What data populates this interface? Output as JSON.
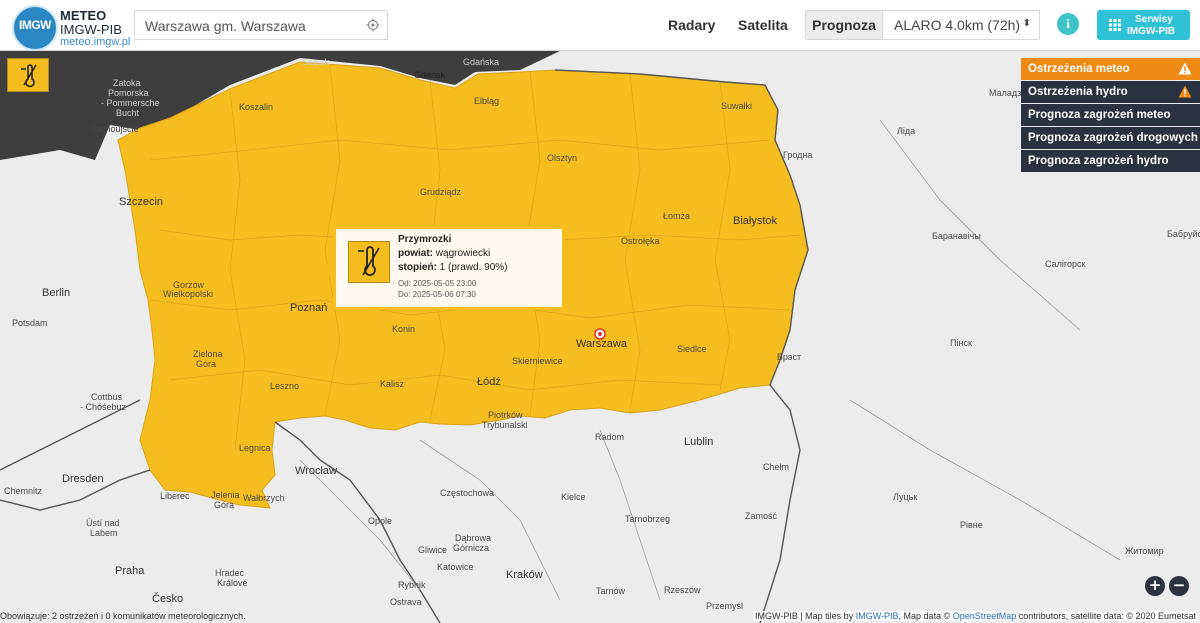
{
  "header": {
    "logo_text": "IMGW",
    "brand_title": "METEO",
    "brand_subtitle": "IMGW-PIB",
    "brand_url": "meteo.imgw.pl",
    "search_value": "Warszawa gm. Warszawa",
    "nav": {
      "radary": "Radary",
      "satelita": "Satelita"
    },
    "prognoza_label": "Prognoza",
    "model_value": "ALARO 4.0km (72h)",
    "info_label": "i",
    "serwisy_line1": "Serwisy",
    "serwisy_line2": "IMGW-PIB"
  },
  "menu": [
    {
      "label": "Ostrzeżenia meteo",
      "active": true,
      "icon": "warning-icon"
    },
    {
      "label": "Ostrzeżenia hydro",
      "active": false,
      "icon": "warning-icon"
    },
    {
      "label": "Prognoza zagrożeń meteo",
      "active": false
    },
    {
      "label": "Prognoza zagrożeń drogowych",
      "active": false
    },
    {
      "label": "Prognoza zagrożeń hydro",
      "active": false
    }
  ],
  "popup": {
    "title": "Przymrozki",
    "powiat_label": "powiat:",
    "powiat_value": "wągrowiecki",
    "stopien_label": "stopień:",
    "stopien_value": "1 (prawd. 90%)",
    "od": "Od: 2025-05-05 23:00",
    "do": "Do: 2025-05-06 07:30"
  },
  "map": {
    "warning_color": "#f5bd1e",
    "cities": {
      "slupsk": "Słupsk",
      "gdansk": "Gdańsk",
      "elblag": "Elbląg",
      "koszalin": "Koszalin",
      "suwalki": "Suwałki",
      "swinoujscie": "Świnoujście",
      "olsztyn": "Olsztyn",
      "szczecin": "Szczecin",
      "grudziadz": "Grudziądz",
      "lomza": "Łomża",
      "bialystok": "Białystok",
      "ostroleka": "Ostrołęka",
      "berlin": "Berlin",
      "gorzow": "Gorzów",
      "gorzow2": "Wielkopolski",
      "poznan": "Poznań",
      "konin": "Konin",
      "potsdam": "Potsdam",
      "warszawa": "Warszawa",
      "siedlce": "Siedlce",
      "skierniewice": "Skierniewice",
      "zielona": "Zielona",
      "gora": "Góra",
      "kalisz": "Kalisz",
      "lodz": "Łódź",
      "leszno": "Leszno",
      "cottbus": "Cottbus",
      "chosebuz": "- Chóśebuz",
      "piotrkow": "Piotrków",
      "trybunalski": "Trybunalski",
      "radom": "Radom",
      "lublin": "Lublin",
      "legnica": "Legnica",
      "wroclaw": "Wrocław",
      "chelm": "Chełm",
      "dresden": "Dresden",
      "chemnitz": "Chemnitz",
      "liberec": "Liberec",
      "jelenia": "Jelenia",
      "gora2": "Góra",
      "walbrzych": "Wałbrzych",
      "czestochowa": "Częstochowa",
      "kielce": "Kielce",
      "usti": "Ústí nad",
      "labem": "Labem",
      "opole": "Opole",
      "dabrowa": "Dąbrowa",
      "gornicza": "Górnicza",
      "tarnobrzeg": "Tarnobrzeg",
      "zamosc": "Zamość",
      "gliwice": "Gliwice",
      "katowice": "Katowice",
      "praha": "Praha",
      "hradec": "Hradec",
      "kralove": "Králové",
      "rybnik": "Rybnik",
      "krakow": "Kraków",
      "tarnow": "Tarnów",
      "rzeszow": "Rzeszów",
      "cesko": "Česko",
      "ostrava": "Ostrava",
      "przemysl": "Przemyśl",
      "malady": "Маладз",
      "lida": "Ліда",
      "grodna": "Гродна",
      "baranavichy": "Баранавічы",
      "babruysk": "Бабруйс",
      "salihorsk": "Салігорск",
      "pinsk": "Пінск",
      "brest": "Брэст",
      "lutsk": "Луцьк",
      "rivne": "Рівне",
      "zhytomyr": "Житомир",
      "pomorze1": "Zatoka",
      "pomorze2": "Pomorska",
      "pomorze3": "- Pommersche",
      "pomorze4": "Bucht",
      "gdansk_gulf": "Gdańska"
    }
  },
  "footer": {
    "status": "Obowiązuje: 2 ostrzeżeń i 0 komunikatów meteorologicznych.",
    "attrib_prefix": "IMGW-PIB | Map tiles by ",
    "attrib_tiles": "IMGW-PIB",
    "attrib_mid": ", Map data © ",
    "attrib_osm": "OpenStreetMap",
    "attrib_suffix": " contributors, satellite data: © 2020 Eumetsat"
  },
  "zoom": {
    "plus": "+",
    "minus": "−"
  }
}
